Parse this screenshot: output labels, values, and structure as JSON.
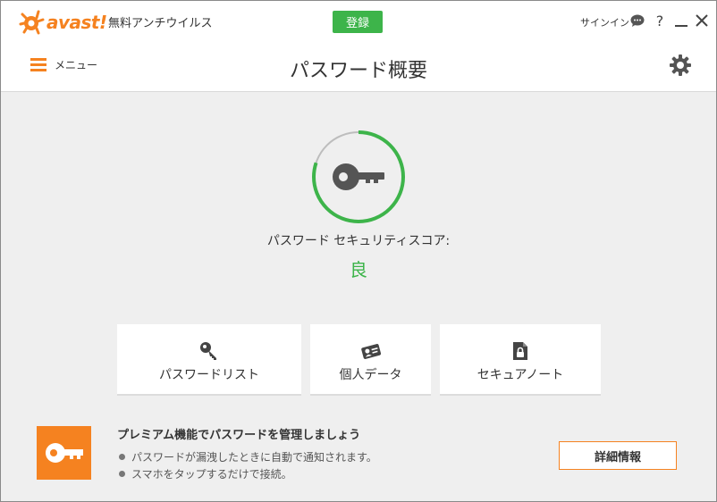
{
  "titlebar": {
    "logo_text": "avast!",
    "app_name": "無料アンチウイルス",
    "register_label": "登録",
    "signin_label": "サインイン",
    "help_glyph": "?"
  },
  "header": {
    "menu_label": "メニュー",
    "title": "パスワード概要"
  },
  "score": {
    "label": "パスワード セキュリティスコア:",
    "value": "良",
    "ring_fraction": 0.8
  },
  "cards": [
    {
      "label": "パスワードリスト",
      "icon": "key-icon"
    },
    {
      "label": "個人データ",
      "icon": "id-card-icon"
    },
    {
      "label": "セキュアノート",
      "icon": "lock-note-icon"
    }
  ],
  "premium": {
    "title": "プレミアム機能でパスワードを管理しましょう",
    "bullets": [
      "パスワードが漏洩したときに自動で通知されます。",
      "スマホをタップするだけで接続。"
    ],
    "details_label": "詳細情報"
  },
  "colors": {
    "brand_orange": "#f58220",
    "accent_green": "#3db44a"
  }
}
